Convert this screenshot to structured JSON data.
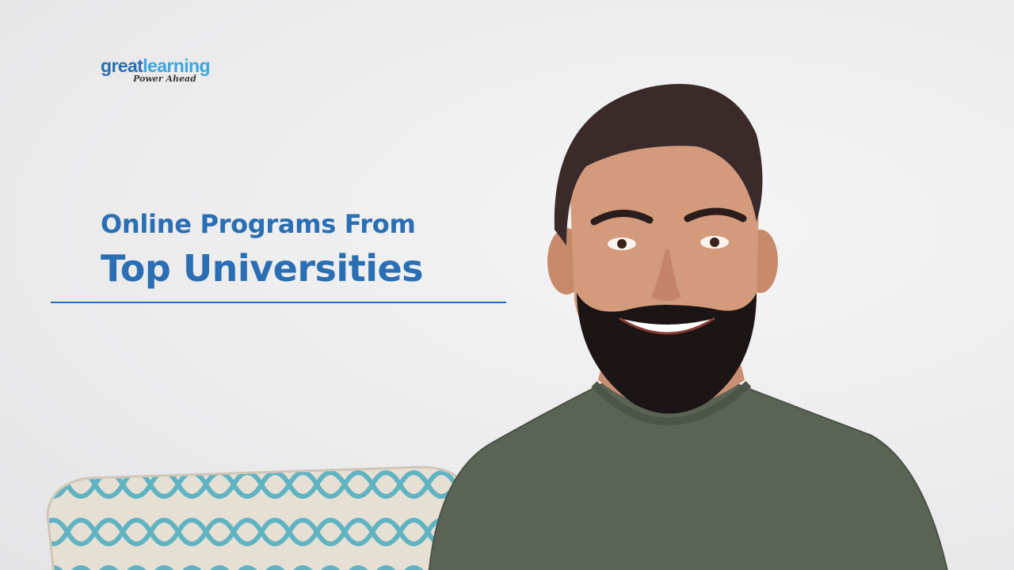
{
  "logo": {
    "word_great": "great",
    "word_learning": "learning",
    "tagline": "Power Ahead"
  },
  "headline": {
    "line1": "Online Programs From",
    "line2": "Top Universities"
  },
  "colors": {
    "brand_blue": "#2a6fb3",
    "brand_light_blue": "#3aa7e0",
    "background": "#eeeeef"
  }
}
